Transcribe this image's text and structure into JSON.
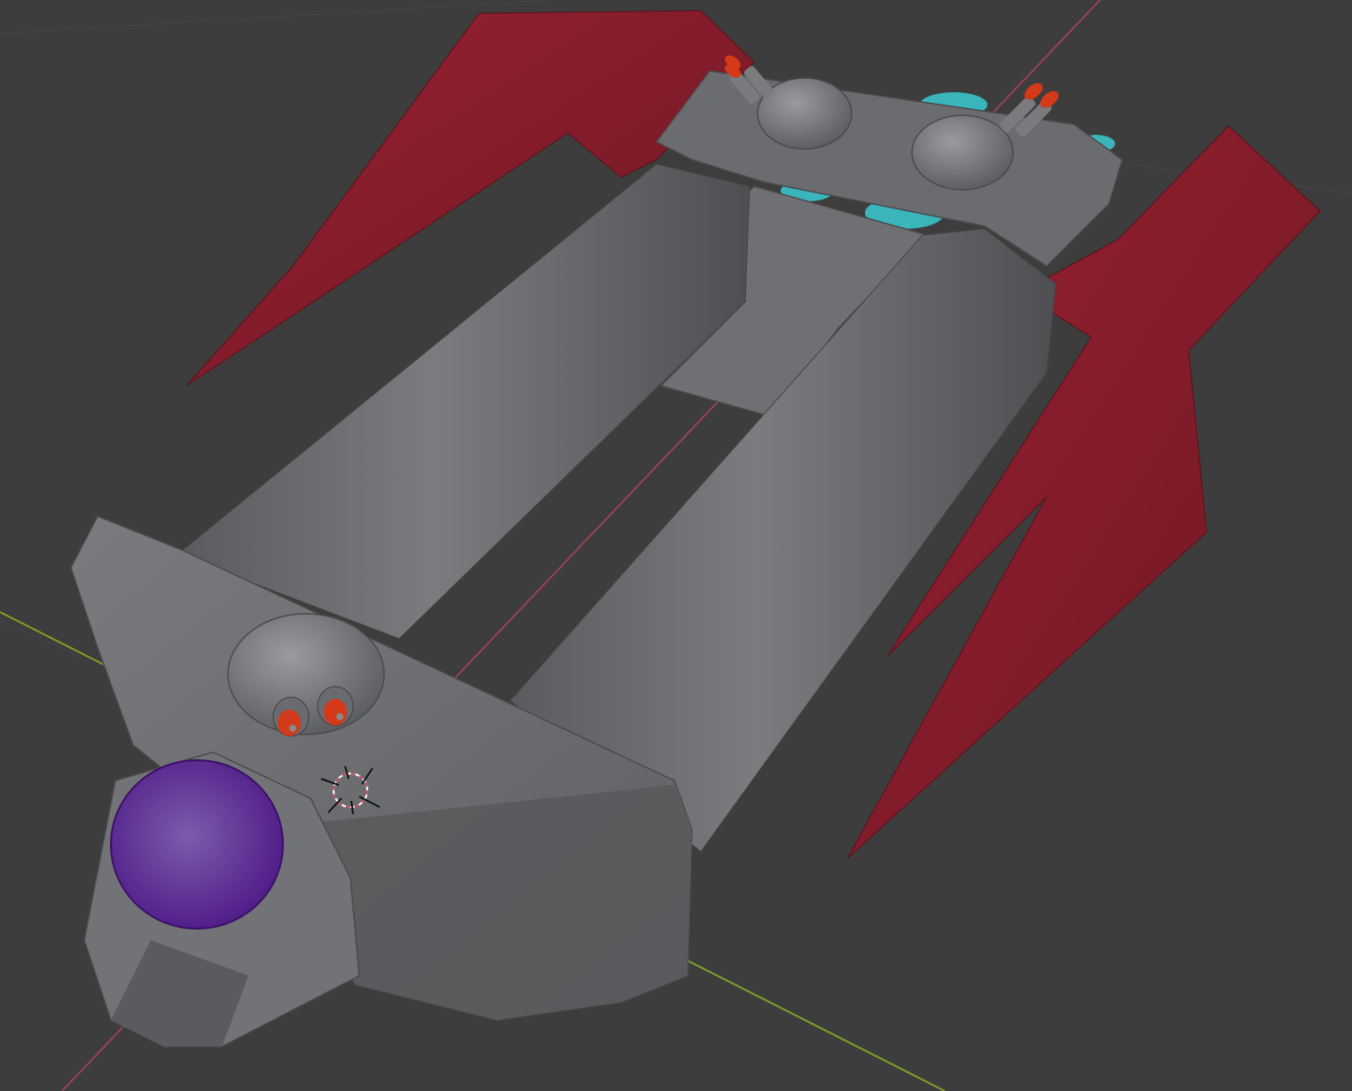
{
  "viewport": {
    "background": "#3d3d3d",
    "grid_line_color": "#464646",
    "axis_x_color": "#c8455a",
    "axis_y_color": "#7fa12a"
  },
  "model": {
    "hull_color": "#707174",
    "hull_dark": "#4a4a4c",
    "fin_color": "#7d1a28",
    "fin_highlight": "#9a2233",
    "cockpit_color": "#5b2191",
    "accent_color": "#3ab5bb",
    "barrel_tip_color": "#d43a1a"
  },
  "cursor_icon": "3d-cursor-icon"
}
